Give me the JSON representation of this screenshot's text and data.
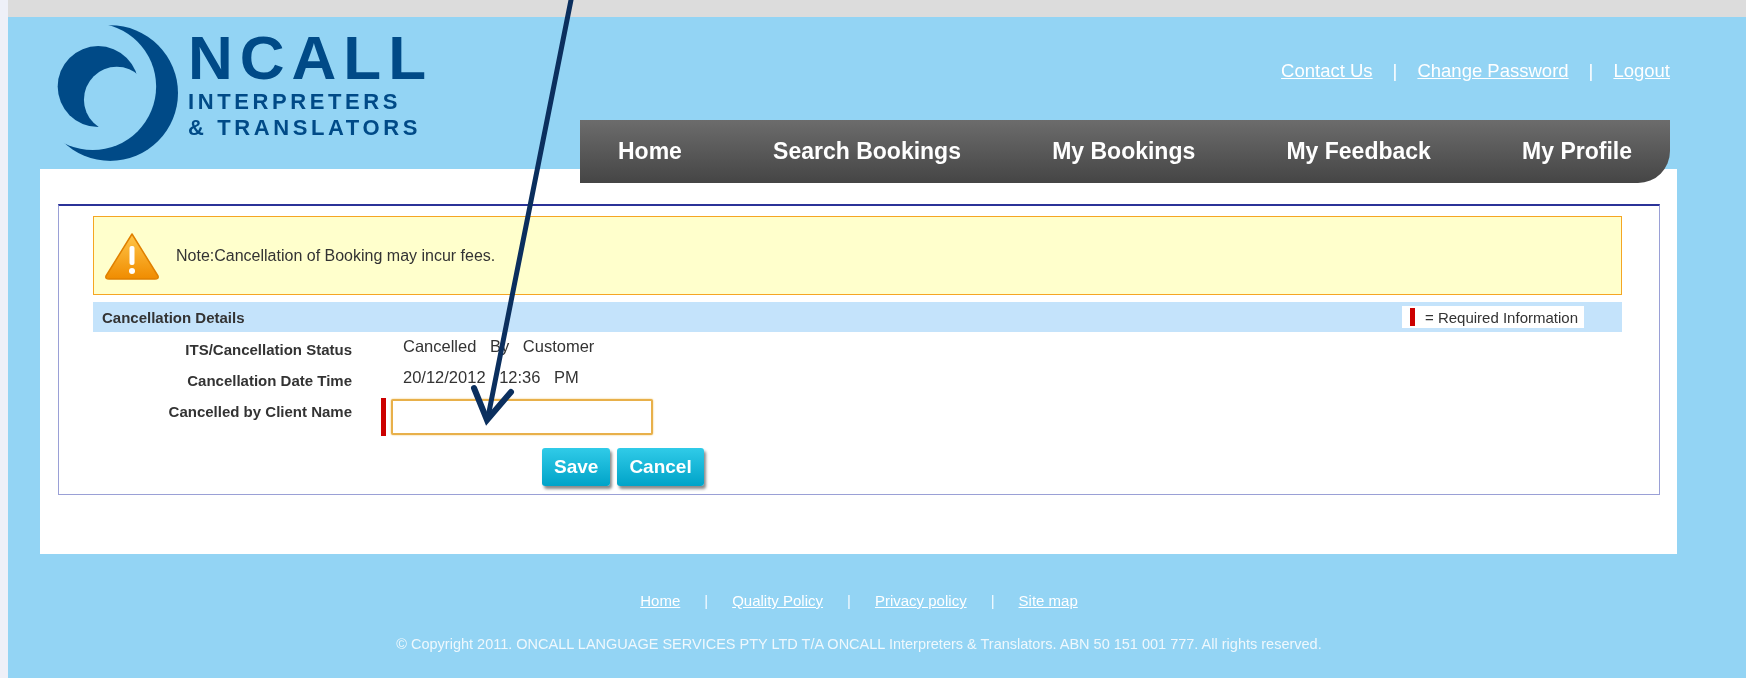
{
  "logo": {
    "wordmark": "NCALL",
    "line_1": "INTERPRETERS",
    "line_2": "& TRANSLATORS"
  },
  "top_links": {
    "separator": "|",
    "items": [
      {
        "label": "Contact Us"
      },
      {
        "label": "Change Password"
      },
      {
        "label": "Logout"
      }
    ]
  },
  "nav": {
    "items": [
      {
        "label": "Home"
      },
      {
        "label": "Search Bookings"
      },
      {
        "label": "My Bookings"
      },
      {
        "label": "My Feedback"
      },
      {
        "label": "My Profile"
      }
    ]
  },
  "note": {
    "text": "Note:Cancellation of Booking may incur fees."
  },
  "section": {
    "title": "Cancellation Details",
    "legend": "= Required Information"
  },
  "fields": [
    {
      "label": "ITS/Cancellation Status",
      "kind": "text",
      "value": "Cancelled By Customer"
    },
    {
      "label": "Cancellation Date Time",
      "kind": "text",
      "value": "20/12/2012 12:36 PM"
    },
    {
      "label": "Cancelled by Client Name",
      "kind": "input",
      "required": true,
      "focused": true
    }
  ],
  "buttons": [
    {
      "label": "Save"
    },
    {
      "label": "Cancel"
    }
  ],
  "footer": {
    "separator": "|",
    "links": [
      {
        "label": "Home"
      },
      {
        "label": "Quality Policy"
      },
      {
        "label": "Privacy policy"
      },
      {
        "label": "Site map"
      }
    ],
    "copyright": "© Copyright 2011. ONCALL LANGUAGE SERVICES PTY LTD T/A ONCALL Interpreters & Translators. ABN 50 151 001 777. All rights reserved."
  }
}
